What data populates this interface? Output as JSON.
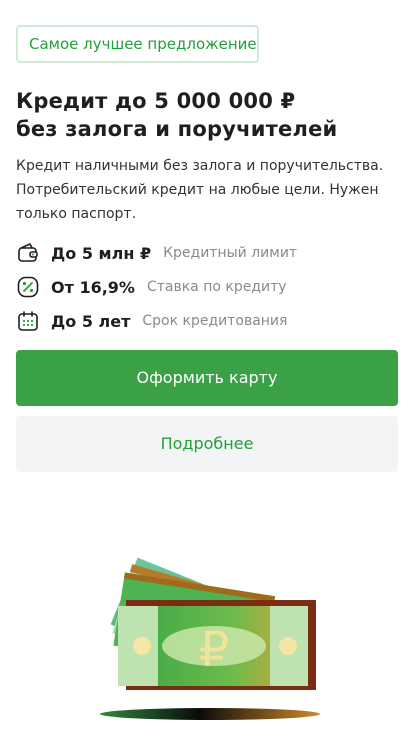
{
  "promo": {
    "badge_text": "Самое лучшее предложение",
    "title_line1": "Кредит до 5 000 000 ₽",
    "title_line2": "без залога и поручителей",
    "description": "Кредит наличными без залога и поручительства. Потребительский кредит на любые цели. Нужен только паспорт."
  },
  "features": [
    {
      "icon": "wallet-icon",
      "value": "До 5 млн ₽",
      "label": "Кредитный лимит"
    },
    {
      "icon": "percent-icon",
      "value": "От 16,9%",
      "label": "Ставка по кредиту"
    },
    {
      "icon": "calendar-icon",
      "value": "До 5 лет",
      "label": "Срок кредитования"
    }
  ],
  "actions": {
    "primary_label": "Оформить карту",
    "secondary_label": "Подробнее"
  },
  "illustration": {
    "name": "money-stack-illustration",
    "currency_symbol": "₽"
  },
  "colors": {
    "brand_green": "#21a038",
    "button_green": "#3aa147",
    "badge_border": "#cfe9d2",
    "secondary_bg": "#f3f4f5"
  }
}
